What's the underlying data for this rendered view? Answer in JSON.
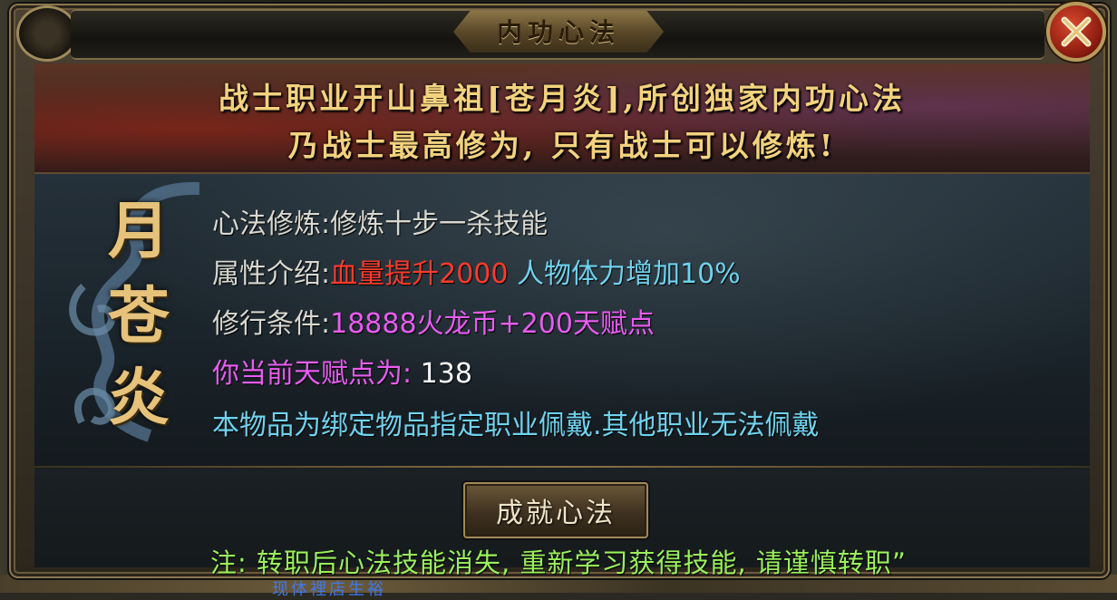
{
  "dialog": {
    "title": "内功心法",
    "banner_line1": "战士职业开山鼻祖[苍月炎],所创独家内功心法",
    "banner_line2": "乃战士最高修为, 只有战士可以修炼!",
    "emblem_chars": [
      "月",
      "苍",
      "炎"
    ],
    "rows": {
      "skill_label": "心法修炼:",
      "skill_value": "修炼十步一杀技能",
      "attr_label": "属性介绍:",
      "attr_red": "血量提升2000",
      "attr_cyan": " 人物体力增加10%",
      "req_label": "修行条件:",
      "req_value": "18888火龙币+200天赋点",
      "talent_label": "你当前天赋点为:",
      "talent_value": " 138",
      "bind_note": "本物品为绑定物品指定职业佩戴.其他职业无法佩戴"
    },
    "action_button": "成就心法",
    "footer_note": "注: 转职后心法技能消失, 重新学习获得技能, 请谨慎转职”",
    "close_icon": "close-x-icon"
  },
  "background": {
    "partial_text": "现体裡店生裕"
  },
  "colors": {
    "banner_gold": "#f3d27e",
    "red": "#ff3a2a",
    "cyan": "#6fd2ee",
    "magenta": "#e85cf0",
    "note_green": "#9af05c"
  }
}
